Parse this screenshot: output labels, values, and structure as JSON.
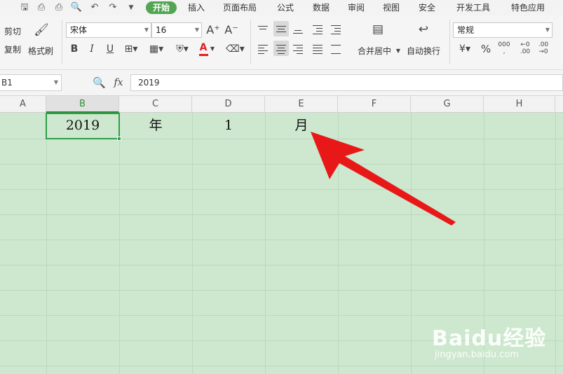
{
  "menu": {
    "tabs": [
      {
        "label": "开始",
        "active": true
      },
      {
        "label": "插入"
      },
      {
        "label": "页面布局"
      },
      {
        "label": "公式"
      },
      {
        "label": "数据"
      },
      {
        "label": "审阅"
      },
      {
        "label": "视图"
      },
      {
        "label": "安全"
      },
      {
        "label": "开发工具"
      },
      {
        "label": "特色应用"
      }
    ],
    "accent_color": "#52a653"
  },
  "ribbon": {
    "cut_label": "剪切",
    "copy_label": "复制",
    "format_painter_label": "格式刷",
    "font_name": "宋体",
    "font_size": "16",
    "bold_label": "B",
    "italic_label": "I",
    "underline_label": "U",
    "merge_center_label": "合并居中",
    "wrap_text_label": "自动换行",
    "number_format": "常规",
    "percent_label": "%"
  },
  "formula_bar": {
    "name_box": "B1",
    "fx_label": "fx",
    "value": "2019"
  },
  "sheet": {
    "columns": [
      "A",
      "B",
      "C",
      "D",
      "E",
      "F",
      "G",
      "H"
    ],
    "selected_column": "B",
    "row1": {
      "B": "2019",
      "C": "年",
      "D": "1",
      "E": "月"
    },
    "grid_color": "#cde8cf",
    "selection_color": "#2e9e48",
    "arrow_color": "#e81818"
  },
  "watermark": {
    "brand": "Baidu经验",
    "url": "jingyan.baidu.com"
  }
}
